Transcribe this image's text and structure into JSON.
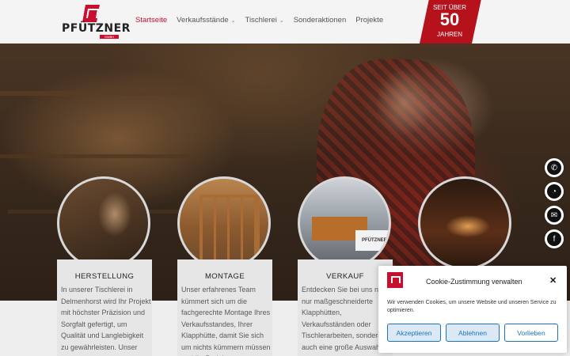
{
  "header": {
    "logo_text": "PFÜTZNER",
    "logo_sub": "GMBH",
    "nav": [
      {
        "label": "Startseite",
        "active": true,
        "has_dropdown": false
      },
      {
        "label": "Verkaufsstände",
        "active": false,
        "has_dropdown": true
      },
      {
        "label": "Tischlerei",
        "active": false,
        "has_dropdown": true
      },
      {
        "label": "Sonderaktionen",
        "active": false,
        "has_dropdown": false
      },
      {
        "label": "Projekte",
        "active": false,
        "has_dropdown": false
      }
    ],
    "badge": {
      "line1": "SEIT ÜBER",
      "line2": "50",
      "line3": "JAHREN"
    }
  },
  "cards": [
    {
      "title": "HERSTELLUNG",
      "text": "In unserer Tischlerei in Delmenhorst wird Ihr Projekt mit höchster Präzision und Sorgfalt gefertigt, um Qualität und Langlebigkeit zu gewährleisten. Unser"
    },
    {
      "title": "MONTAGE",
      "text": "Unser erfahrenes Team kümmert sich um die fachgerechte Montage Ihres Verkaufsstandes, Ihrer Klapphütte, damit Sie sich um nichts kümmern müssen und Ihr Projekt"
    },
    {
      "title": "VERKAUF",
      "text": "Entdecken Sie bei uns nicht nur maßgeschneiderte Klapphütten, Verkaufsständen oder Tischlerarbeiten, sondern auch eine große Auswahl"
    },
    {
      "title": "",
      "text": ""
    }
  ],
  "contact_icons": [
    "phone-icon",
    "whatsapp-icon",
    "mail-icon",
    "facebook-icon"
  ],
  "cookie": {
    "title": "Cookie-Zustimmung verwalten",
    "message": "Wir verwenden Cookies, um unsere Website und unseren Service zu optimieren.",
    "accept": "Akzeptieren",
    "reject": "Ablehnen",
    "prefs": "Vorlieben",
    "close": "✕"
  },
  "colors": {
    "brand_red": "#c8102e",
    "cookie_blue": "#1e73be"
  }
}
